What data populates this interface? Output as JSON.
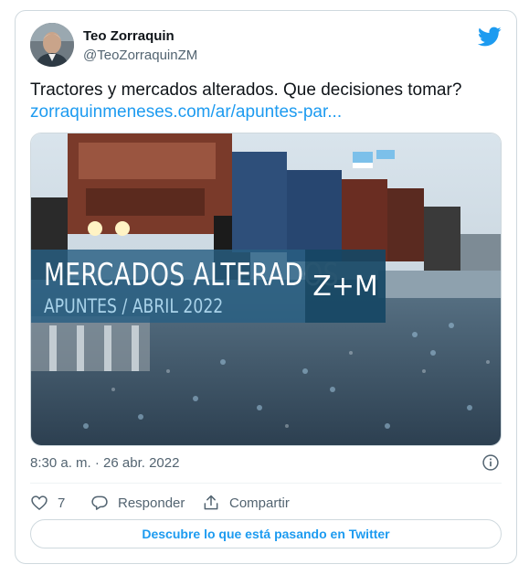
{
  "author": {
    "display_name": "Teo Zorraquin",
    "handle": "@TeoZorraquinZM"
  },
  "tweet": {
    "text": "Tractores y mercados alterados. Que decisiones tomar?",
    "link": "zorraquinmeneses.com/ar/apuntes-par...",
    "timestamp": "8:30 a. m. · 26 abr. 2022"
  },
  "media": {
    "banner_title": "MERCADOS ALTERADOS",
    "banner_subtitle": "APUNTES / ABRIL 2022",
    "logo": "Z+M"
  },
  "actions": {
    "like_count": "7",
    "reply_label": "Responder",
    "share_label": "Compartir"
  },
  "cta_label": "Descubre lo que está pasando en Twitter",
  "colors": {
    "twitter_blue": "#1d9bf0",
    "text_primary": "#0f1419",
    "text_secondary": "#536471",
    "border": "#cfd9de"
  },
  "icons": [
    "twitter-bird-icon",
    "info-icon",
    "heart-icon",
    "reply-icon",
    "share-icon"
  ]
}
